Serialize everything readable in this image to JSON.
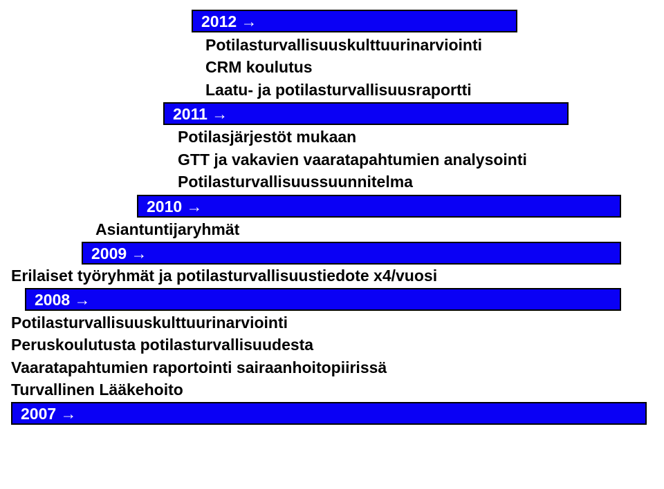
{
  "bands": {
    "b2012": "2012 →",
    "b2011": "2011 →",
    "b2010": "2010 →",
    "b2009": "2009 →",
    "b2008": "2008 →",
    "b2007": "2007 →"
  },
  "text": {
    "t2012_1": "Potilasturvallisuuskulttuurinarviointi",
    "t2012_2": "CRM koulutus",
    "t2012_3": "Laatu- ja potilasturvallisuusraportti",
    "t2011_1": "Potilasjärjestöt mukaan",
    "t2011_2": "GTT ja vakavien vaaratapahtumien analysointi",
    "t2011_3": "Potilasturvallisuussuunnitelma",
    "t2010_1": "Asiantuntijaryhmät",
    "t2009_1": "Erilaiset työryhmät ja potilasturvallisuustiedote x4/vuosi",
    "t2008_1": "Potilasturvallisuuskulttuurinarviointi",
    "t2008_2": "Peruskoulutusta potilasturvallisuudesta",
    "t2008_3": "Vaaratapahtumien raportointi sairaanhoitopiirissä",
    "t2008_4": "Turvallinen Lääkehoito"
  }
}
